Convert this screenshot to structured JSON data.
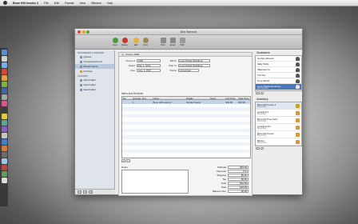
{
  "menubar": {
    "app_name": "Bone Hill Invoice 2",
    "menus": [
      "File",
      "Edit",
      "Format",
      "View",
      "Window",
      "Help"
    ],
    "status": [
      "",
      "",
      ""
    ]
  },
  "window": {
    "title": "Bob Warwick"
  },
  "toolbar": [
    {
      "label": "New",
      "color": "#4a9a3a"
    },
    {
      "label": "Delete",
      "color": "#c9342b"
    },
    {
      "label": "Edit",
      "color": "#e0b23a"
    },
    {
      "label": "Find",
      "color": "#9b8b5a"
    },
    {
      "label": "Print",
      "color": "#8a8a8a"
    },
    {
      "label": "Email",
      "color": "#8a8a8a"
    },
    {
      "label": "PDF",
      "color": "#9a9a9a"
    }
  ],
  "sidebar": {
    "groups": [
      {
        "heading": "DOCUMENTS & REVIEWS",
        "items": [
          {
            "label": "Quotes",
            "selected": false
          },
          {
            "label": "Unresolved Items",
            "selected": false
          },
          {
            "label": "Recent Items",
            "selected": true
          },
          {
            "label": "Invoices",
            "selected": false
          }
        ]
      },
      {
        "heading": "FOLDERS",
        "items": [
          {
            "label": "New Folder",
            "selected": false
          },
          {
            "label": "New Folder",
            "selected": false
          },
          {
            "label": "New Folder",
            "selected": false
          }
        ]
      }
    ]
  },
  "invoice": {
    "tab_label": "Invoice 1048",
    "fields": {
      "invoice_num_label": "Invoice #",
      "invoice_num": "1048",
      "dated_label": "Dated",
      "dated": "May 1, 2010",
      "due_label": "Due",
      "due": "June 1, 2010",
      "bill_to_label": "Bill To",
      "bill_to": "iLuxe Digital Weddings",
      "ship_to_label": "Ship To",
      "ship_to": "iLuxe Digital Weddings",
      "status_label": "Status",
      "status": "Unresolved"
    },
    "items_title": "Items and Services",
    "table": {
      "headers": [
        "Kit",
        "Quantity",
        "Item",
        "Name",
        "Details",
        "Taxes",
        "Unit Price",
        "Total Price"
      ],
      "rows": [
        [
          "",
          "1",
          "",
          "Bone Hill Invoice 2",
          "Simple Invoice",
          "",
          "$49.99",
          "$49.99"
        ]
      ]
    },
    "notes_label": "Notes",
    "totals": [
      {
        "label": "Subtotal",
        "value": "$49.99"
      },
      {
        "label": "Discount",
        "value": "0 %"
      },
      {
        "label": "Shipping",
        "value": "$0.00"
      },
      {
        "label": "Tax",
        "value": "$0.00"
      },
      {
        "label": "Total",
        "value": "$49.99"
      },
      {
        "label": "Paid",
        "value": "$49.99"
      },
      {
        "label": "Balance Due",
        "value": "$0.00"
      }
    ]
  },
  "customers": {
    "title": "Customers",
    "items": [
      {
        "name": "Graham Barnett"
      },
      {
        "name": "Sally Parks"
      },
      {
        "name": "Silksmes Inc"
      },
      {
        "name": "Tod Tori"
      },
      {
        "name": "Tony Abbott"
      },
      {
        "name": "iLuxe Digital Weddings",
        "sub": "Bob Warwick"
      }
    ],
    "selected_index": 5
  },
  "products": {
    "title": "Inventory",
    "items": [
      {
        "name": "Bone Hill Invoice 2",
        "sub": "Boxed App"
      },
      {
        "name": "Locations 2",
        "sub": "Boxed App"
      },
      {
        "name": "Bone Hill Time Card",
        "sub": "Boxed App"
      },
      {
        "name": "Locations Pro",
        "sub": "Boxed App"
      },
      {
        "name": "Bone Hill Invoice",
        "sub": "Boxed App"
      },
      {
        "name": "BitJots",
        "sub": "Boxed App"
      }
    ],
    "selected_index": 0
  }
}
